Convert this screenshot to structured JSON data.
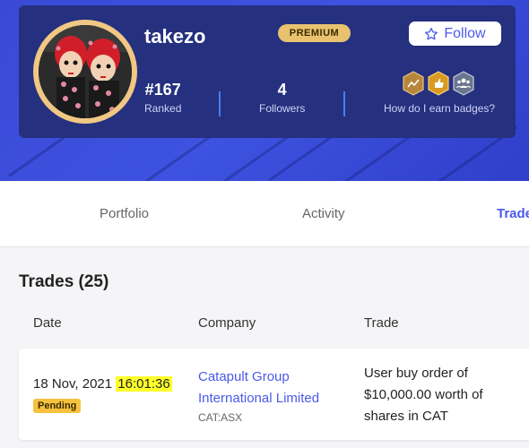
{
  "profile": {
    "username": "takezo",
    "tier": "PREMIUM",
    "follow_label": "Follow",
    "rank_value": "#167",
    "rank_label": "Ranked",
    "followers_value": "4",
    "followers_label": "Followers",
    "badges_help": "How do I earn badges?",
    "badges": [
      {
        "icon": "chart-badge-icon",
        "color": "#b8863b"
      },
      {
        "icon": "thumbs-up-badge-icon",
        "color": "#d89a22"
      },
      {
        "icon": "group-badge-icon",
        "color": "#6a7690"
      }
    ]
  },
  "tabs": [
    {
      "label": "Portfolio",
      "active": false
    },
    {
      "label": "Activity",
      "active": false
    },
    {
      "label": "Trade",
      "active": true
    }
  ],
  "trades": {
    "title": "Trades (25)",
    "columns": [
      "Date",
      "Company",
      "Trade"
    ],
    "rows": [
      {
        "date": "18 Nov, 2021",
        "time": "16:01:36",
        "status": "Pending",
        "company": "Catapult Group International Limited",
        "ticker": "CAT:ASX",
        "trade": "User buy order of $10,000.00 worth of shares in CAT"
      }
    ]
  },
  "colors": {
    "accent": "#4a5ae8",
    "banner": "#3a4ad6",
    "card": "#25307f",
    "premium": "#e8c26e",
    "pending": "#f6c23e",
    "highlight": "#ffff2a"
  }
}
